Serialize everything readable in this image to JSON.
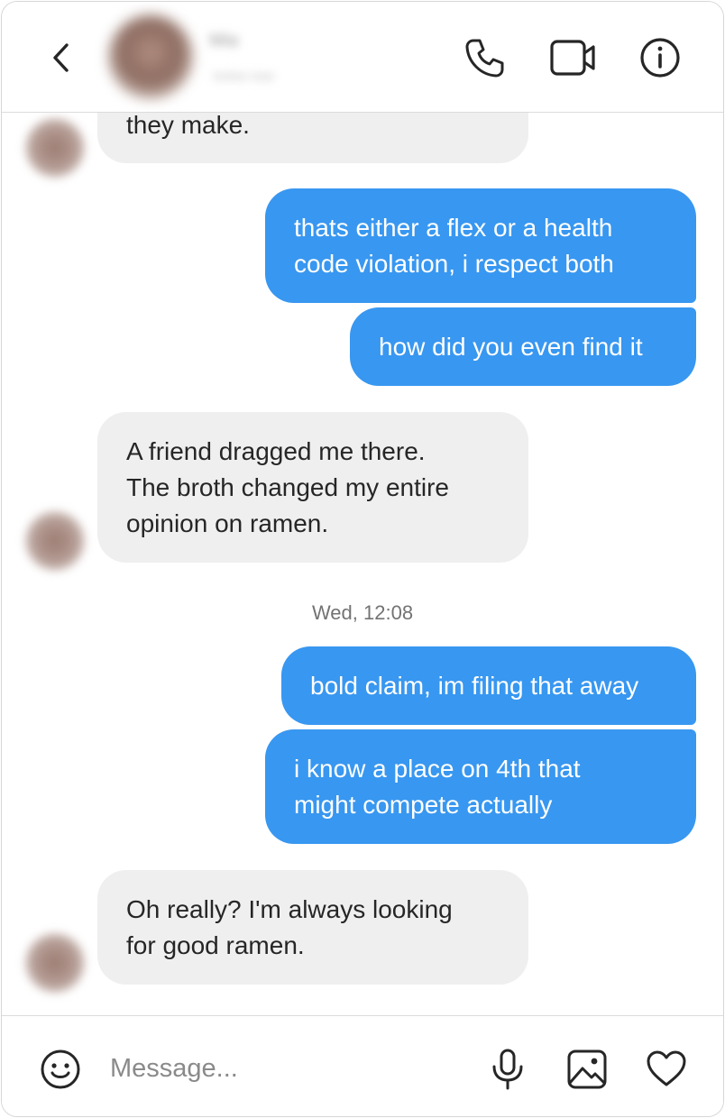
{
  "header": {
    "contact_name": "Mia",
    "contact_status": "Active now",
    "icons": [
      "back-icon",
      "phone-icon",
      "video-icon",
      "info-icon"
    ]
  },
  "messages": [
    {
      "side": "in",
      "text": "they make."
    },
    {
      "side": "out",
      "text": "thats either a flex or a health\ncode violation, i respect both"
    },
    {
      "side": "out",
      "text": "how did you even find it"
    },
    {
      "side": "in",
      "text": "A friend dragged me there.\nThe broth changed my entire\nopinion on ramen."
    },
    {
      "side": "out",
      "text": "bold claim, im filing that away"
    },
    {
      "side": "out",
      "text": "i know a place on 4th that\nmight compete actually"
    },
    {
      "side": "in",
      "text": "Oh really? I'm always looking\nfor good ramen."
    }
  ],
  "timestamp": "Wed, 12:08",
  "composer": {
    "placeholder": "Message...",
    "value": "",
    "icons": [
      "emoji-icon",
      "microphone-icon",
      "image-icon",
      "heart-icon"
    ]
  },
  "colors": {
    "outgoing_bubble": "#3897f0",
    "incoming_bubble": "#efefef",
    "text": "#262626"
  }
}
